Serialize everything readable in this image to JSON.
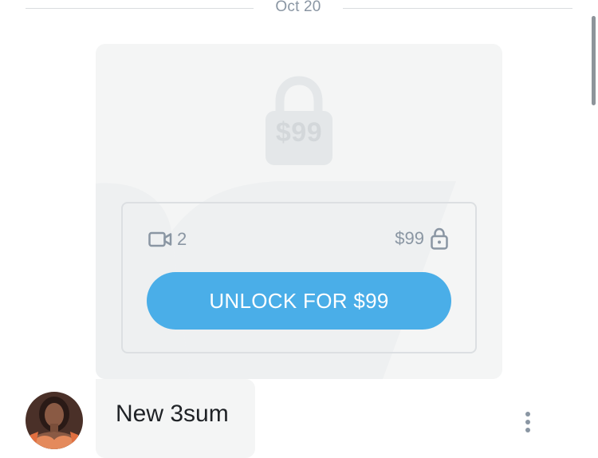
{
  "divider": {
    "date": "Oct 20"
  },
  "media": {
    "lock_price": "$99",
    "video_count": "2",
    "price": "$99",
    "unlock_label": "UNLOCK FOR $99",
    "icons": {
      "video": "video-camera-icon",
      "lock": "lock-icon",
      "large_lock": "large-lock-icon"
    }
  },
  "message": {
    "text": "New 3sum"
  },
  "colors": {
    "accent": "#4aaee8",
    "card_bg": "#f4f5f5",
    "muted_text": "#8a96a3"
  }
}
